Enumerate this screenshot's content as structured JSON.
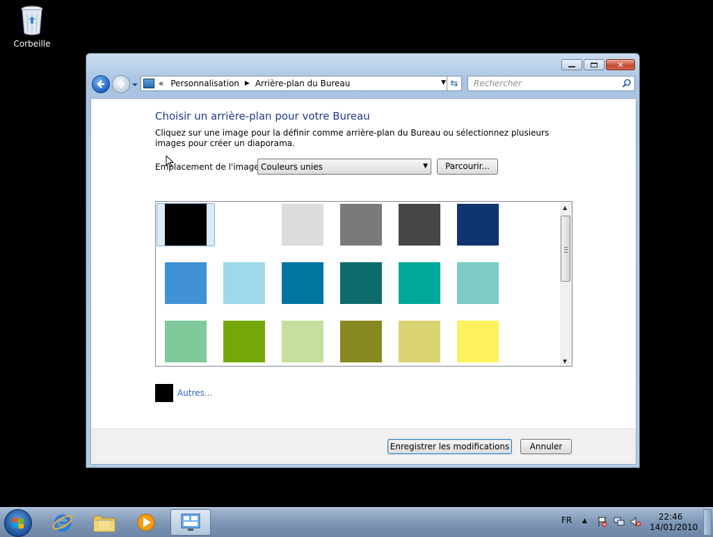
{
  "desktop": {
    "recycle_bin_label": "Corbeille"
  },
  "window": {
    "address": {
      "overflow": "«",
      "crumbs": [
        "Personnalisation",
        "Arrière-plan du Bureau"
      ]
    },
    "search_placeholder": "Rechercher",
    "title": "Choisir un arrière-plan pour votre Bureau",
    "description": "Cliquez sur une image pour la définir comme arrière-plan du Bureau ou sélectionnez plusieurs images pour créer un diaporama.",
    "location_label": "Emplacement de l'image :",
    "location_value": "Couleurs unies",
    "browse_label": "Parcourir...",
    "swatches": [
      [
        "#000000",
        "#ffffff",
        "#dcdcdc",
        "#7a7a7a",
        "#464646",
        "#10346f"
      ],
      [
        "#4192d4",
        "#9ed8ea",
        "#00759f",
        "#0c6b6b",
        "#00a99a",
        "#7ccbc5"
      ],
      [
        "#7fc99b",
        "#75a70a",
        "#c5df9d",
        "#888821",
        "#d9d471",
        "#fff15c"
      ]
    ],
    "selected_swatch": "#000000",
    "other_color": "#000000",
    "other_label": "Autres...",
    "save_label": "Enregistrer les modifications",
    "cancel_label": "Annuler"
  },
  "taskbar": {
    "language": "FR",
    "time": "22:46",
    "date": "14/01/2010"
  }
}
